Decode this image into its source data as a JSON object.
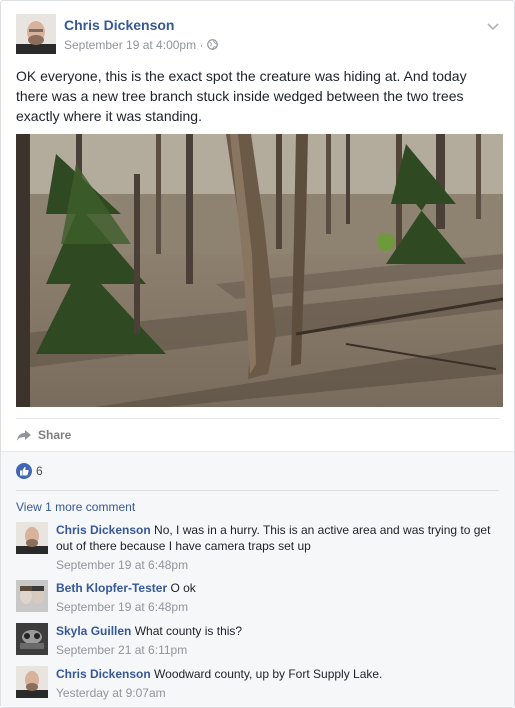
{
  "post": {
    "author": "Chris Dickenson",
    "date": "September 19 at 4:00pm",
    "separator": "·",
    "text": "OK everyone, this is the exact spot the creature was hiding at. And today there was a new tree branch stuck inside wedged between the two trees exactly where it was standing."
  },
  "actions": {
    "share_label": "Share"
  },
  "reactions": {
    "like_count": "6"
  },
  "comments_section": {
    "view_more": "View 1 more comment",
    "items": [
      {
        "author": "Chris Dickenson",
        "text": "No, I was in a hurry. This is an active area and was trying to get out of there because I have camera traps set up",
        "time": "September 19 at 6:48pm"
      },
      {
        "author": "Beth Klopfer-Tester",
        "text": "O ok",
        "time": "September 19 at 6:48pm"
      },
      {
        "author": "Skyla Guillen",
        "text": "What county is this?",
        "time": "September 21 at 6:11pm"
      },
      {
        "author": "Chris Dickenson",
        "text": "Woodward county, up by Fort Supply Lake.",
        "time": "Yesterday at 9:07am"
      }
    ]
  },
  "colors": {
    "link": "#365899",
    "meta": "#90949c",
    "like_badge": "#4267b2",
    "comments_bg": "#f6f7f9"
  },
  "icons": {
    "globe": "globe-icon",
    "chevron": "chevron-down-icon",
    "share": "share-arrow-icon",
    "like": "thumbs-up-icon"
  }
}
